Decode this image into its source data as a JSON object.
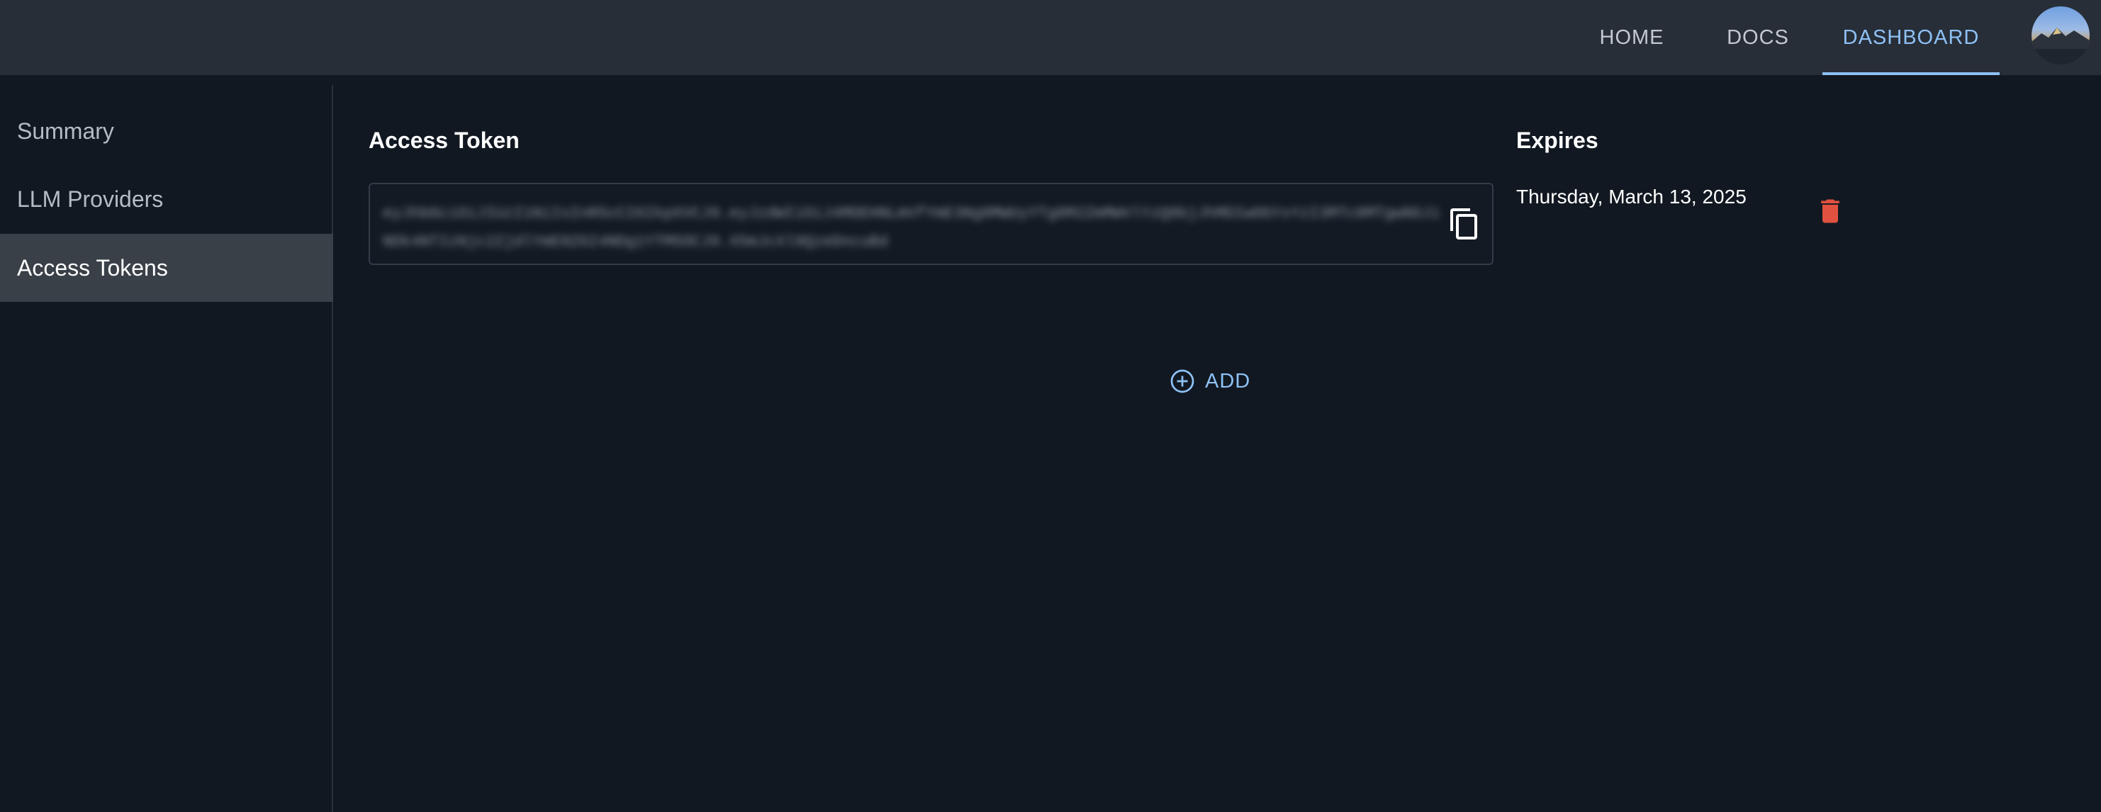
{
  "nav": {
    "items": [
      {
        "label": "HOME",
        "active": false
      },
      {
        "label": "DOCS",
        "active": false
      },
      {
        "label": "DASHBOARD",
        "active": true
      }
    ],
    "avatar_icon": "user-avatar"
  },
  "sidebar": {
    "items": [
      {
        "label": "Summary",
        "active": false
      },
      {
        "label": "LLM Providers",
        "active": false
      },
      {
        "label": "Access Tokens",
        "active": true
      }
    ]
  },
  "tokens": {
    "token_header": "Access Token",
    "expires_header": "Expires",
    "rows": [
      {
        "token": "eyJhbGciOiJIUzI1NiIsInR5cCI6IkpXVCJ9.eyJzdWIiOiJ4MDEHNLmVfYmE3Ng0MWUyYTg0M2ZmMWVlYzQ0bjJhMDIwOGYxYzI3MTc0MTgwNGJiNDk4NTIzNjc2ZjdlYmE0ZGI4NDg1YTM5OCJ9.X5mJcXl9QzeDncuBd",
        "expires": "Thursday, March 13, 2025",
        "copy_icon": "copy-icon",
        "delete_icon": "trash-icon"
      }
    ],
    "add_label": "ADD",
    "add_icon": "plus-circle-icon"
  },
  "colors": {
    "accent": "#8ec1f5",
    "background": "#111821",
    "topbar": "#272e38",
    "delete": "#e0523f"
  }
}
